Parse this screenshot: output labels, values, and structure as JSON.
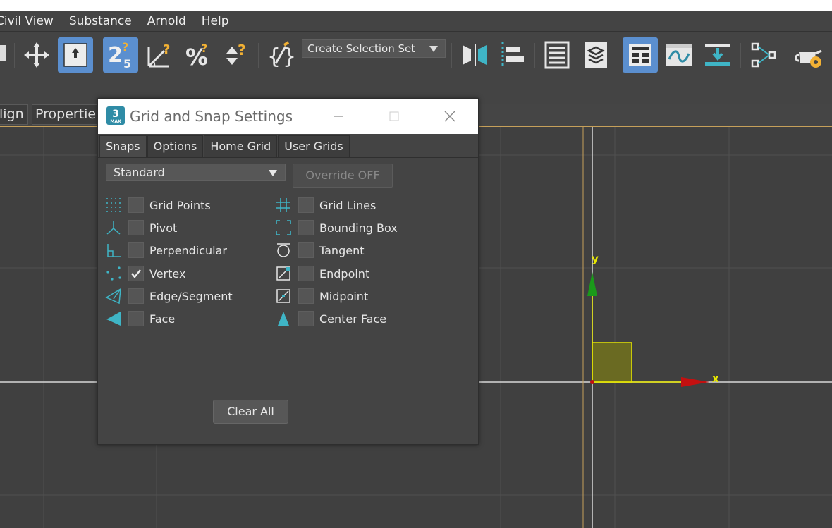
{
  "menubar": {
    "items": [
      "Civil View",
      "Substance",
      "Arnold",
      "Help"
    ]
  },
  "toolbar": {
    "selection_set_placeholder": "Create Selection Set",
    "snap_value": "2",
    "snap_sub": "5"
  },
  "ribbon": {
    "tabs": [
      "lign",
      "Properties"
    ]
  },
  "viewport": {
    "axis_x": "x",
    "axis_y": "y"
  },
  "dialog": {
    "title": "Grid and Snap Settings",
    "logo": "3",
    "logo_sub": "MAX",
    "tabs": [
      "Snaps",
      "Options",
      "Home Grid",
      "User Grids"
    ],
    "active_tab": "Snaps",
    "preset": "Standard",
    "override": "Override OFF",
    "snaps_left": [
      {
        "label": "Grid Points",
        "checked": false,
        "icon": "grid-points-icon"
      },
      {
        "label": "Pivot",
        "checked": false,
        "icon": "pivot-icon"
      },
      {
        "label": "Perpendicular",
        "checked": false,
        "icon": "perpendicular-icon"
      },
      {
        "label": "Vertex",
        "checked": true,
        "icon": "vertex-icon"
      },
      {
        "label": "Edge/Segment",
        "checked": false,
        "icon": "edge-segment-icon"
      },
      {
        "label": "Face",
        "checked": false,
        "icon": "face-icon"
      }
    ],
    "snaps_right": [
      {
        "label": "Grid Lines",
        "checked": false,
        "icon": "grid-lines-icon"
      },
      {
        "label": "Bounding Box",
        "checked": false,
        "icon": "bounding-box-icon"
      },
      {
        "label": "Tangent",
        "checked": false,
        "icon": "tangent-icon"
      },
      {
        "label": "Endpoint",
        "checked": false,
        "icon": "endpoint-icon"
      },
      {
        "label": "Midpoint",
        "checked": false,
        "icon": "midpoint-icon"
      },
      {
        "label": "Center Face",
        "checked": false,
        "icon": "center-face-icon"
      }
    ],
    "clear_all": "Clear All"
  },
  "colors": {
    "accent": "#5b8fcf",
    "snap_teal": "#3fb5c6",
    "axis_x": "#c41010",
    "axis_y": "#1a9a1a",
    "axis_label": "#e8e800"
  }
}
